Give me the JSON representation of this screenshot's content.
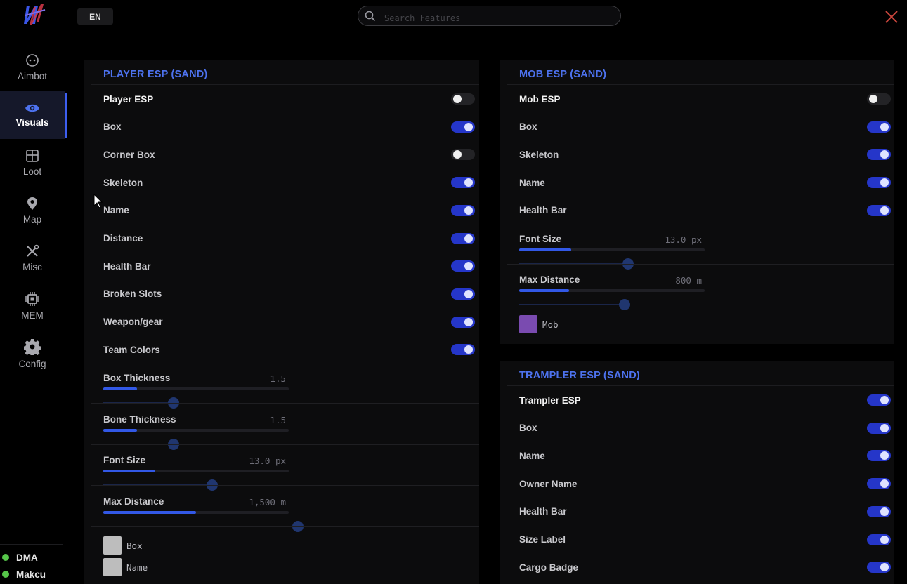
{
  "header": {
    "language": "EN",
    "search_placeholder": "Search Features"
  },
  "sidebar": {
    "items": [
      {
        "label": "Aimbot",
        "icon": "aimbot-icon",
        "active": false
      },
      {
        "label": "Visuals",
        "icon": "eye-icon",
        "active": true
      },
      {
        "label": "Loot",
        "icon": "loot-icon",
        "active": false
      },
      {
        "label": "Map",
        "icon": "map-pin-icon",
        "active": false
      },
      {
        "label": "Misc",
        "icon": "tools-icon",
        "active": false
      },
      {
        "label": "MEM",
        "icon": "chip-icon",
        "active": false
      },
      {
        "label": "Config",
        "icon": "gear-icon",
        "active": false
      }
    ],
    "status": [
      {
        "label": "DMA",
        "color": "#56c64a"
      },
      {
        "label": "Makcu",
        "color": "#56c64a"
      }
    ]
  },
  "colors": {
    "accent": "#3258e6",
    "title": "#4d72ee",
    "close": "#c8453c",
    "mob_swatch": "#7a4bb0",
    "player_swatch": "#bdbdbd"
  },
  "player_esp": {
    "title": "PLAYER ESP (SAND)",
    "toggles": [
      {
        "label": "Player ESP",
        "on": false,
        "main": true
      },
      {
        "label": "Box",
        "on": true
      },
      {
        "label": "Corner Box",
        "on": false
      },
      {
        "label": "Skeleton",
        "on": true
      },
      {
        "label": "Name",
        "on": true
      },
      {
        "label": "Distance",
        "on": true
      },
      {
        "label": "Health Bar",
        "on": true
      },
      {
        "label": "Broken Slots",
        "on": true
      },
      {
        "label": "Weapon/gear",
        "on": true
      },
      {
        "label": "Team Colors",
        "on": true
      }
    ],
    "sliders": [
      {
        "label": "Box Thickness",
        "value": "1.5",
        "level": 0.18
      },
      {
        "label": "Bone Thickness",
        "value": "1.5",
        "level": 0.18
      },
      {
        "label": "Font Size",
        "value": "13.0 px",
        "level": 0.28
      },
      {
        "label": "Max Distance",
        "value": "1,500 m",
        "level": 0.5
      }
    ],
    "swatches": [
      {
        "label": "Box"
      },
      {
        "label": "Name"
      }
    ]
  },
  "mob_esp": {
    "title": "MOB ESP (SAND)",
    "toggles": [
      {
        "label": "Mob ESP",
        "on": false,
        "main": true
      },
      {
        "label": "Box",
        "on": true
      },
      {
        "label": "Skeleton",
        "on": true
      },
      {
        "label": "Name",
        "on": true
      },
      {
        "label": "Health Bar",
        "on": true
      }
    ],
    "sliders": [
      {
        "label": "Font Size",
        "value": "13.0 px",
        "level": 0.28
      },
      {
        "label": "Max Distance",
        "value": "800 m",
        "level": 0.27
      }
    ],
    "swatches": [
      {
        "label": "Mob"
      }
    ]
  },
  "trampler_esp": {
    "title": "TRAMPLER ESP (SAND)",
    "toggles": [
      {
        "label": "Trampler ESP",
        "on": true,
        "main": true
      },
      {
        "label": "Box",
        "on": true
      },
      {
        "label": "Name",
        "on": true
      },
      {
        "label": "Owner Name",
        "on": true
      },
      {
        "label": "Health Bar",
        "on": true
      },
      {
        "label": "Size Label",
        "on": true
      },
      {
        "label": "Cargo Badge",
        "on": true
      }
    ]
  }
}
